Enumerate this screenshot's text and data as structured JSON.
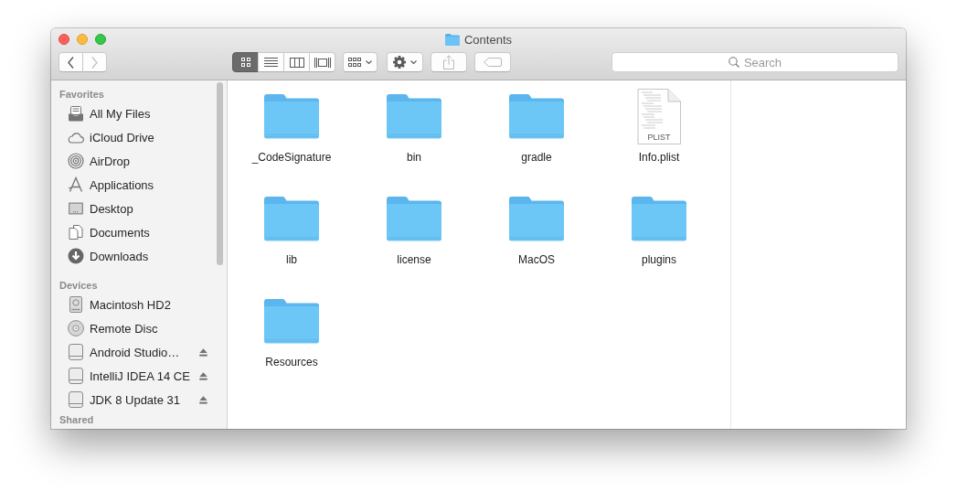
{
  "window": {
    "title": "Contents"
  },
  "toolbar": {
    "nav_buttons": [
      {
        "kind": "back",
        "disabled": false
      },
      {
        "kind": "forward",
        "disabled": true
      }
    ],
    "view_modes": [
      {
        "kind": "icon",
        "selected": true
      },
      {
        "kind": "list",
        "selected": false
      },
      {
        "kind": "column",
        "selected": false
      },
      {
        "kind": "coverflow",
        "selected": false
      }
    ],
    "buttons": [
      {
        "kind": "arrange",
        "disabled": false
      },
      {
        "kind": "action",
        "disabled": false
      },
      {
        "kind": "share",
        "disabled": true
      },
      {
        "kind": "tags",
        "disabled": true
      }
    ],
    "search": {
      "placeholder": "Search"
    }
  },
  "sidebar": {
    "sections": [
      {
        "title": "Favorites",
        "items": [
          {
            "label": "All My Files",
            "kind": "all-files"
          },
          {
            "label": "iCloud Drive",
            "kind": "cloud"
          },
          {
            "label": "AirDrop",
            "kind": "airdrop"
          },
          {
            "label": "Applications",
            "kind": "applications"
          },
          {
            "label": "Desktop",
            "kind": "desktop"
          },
          {
            "label": "Documents",
            "kind": "documents"
          },
          {
            "label": "Downloads",
            "kind": "downloads"
          }
        ]
      },
      {
        "title": "Devices",
        "items": [
          {
            "label": "Macintosh HD2",
            "kind": "hard-disk",
            "ejectable": false
          },
          {
            "label": "Remote Disc",
            "kind": "disc",
            "ejectable": false
          },
          {
            "label": "Android Studio…",
            "kind": "drive",
            "ejectable": true
          },
          {
            "label": "IntelliJ IDEA 14 CE",
            "kind": "drive",
            "ejectable": true
          },
          {
            "label": "JDK 8 Update 31",
            "kind": "drive",
            "ejectable": true
          }
        ]
      },
      {
        "title": "Shared"
      }
    ]
  },
  "content": {
    "items": [
      {
        "name": "_CodeSignature",
        "kind": "folder"
      },
      {
        "name": "bin",
        "kind": "folder"
      },
      {
        "name": "gradle",
        "kind": "folder"
      },
      {
        "name": "Info.plist",
        "kind": "document",
        "type_label": "PLIST"
      },
      {
        "name": "lib",
        "kind": "folder"
      },
      {
        "name": "license",
        "kind": "folder"
      },
      {
        "name": "MacOS",
        "kind": "folder"
      },
      {
        "name": "plugins",
        "kind": "folder"
      },
      {
        "name": "Resources",
        "kind": "folder"
      }
    ]
  }
}
